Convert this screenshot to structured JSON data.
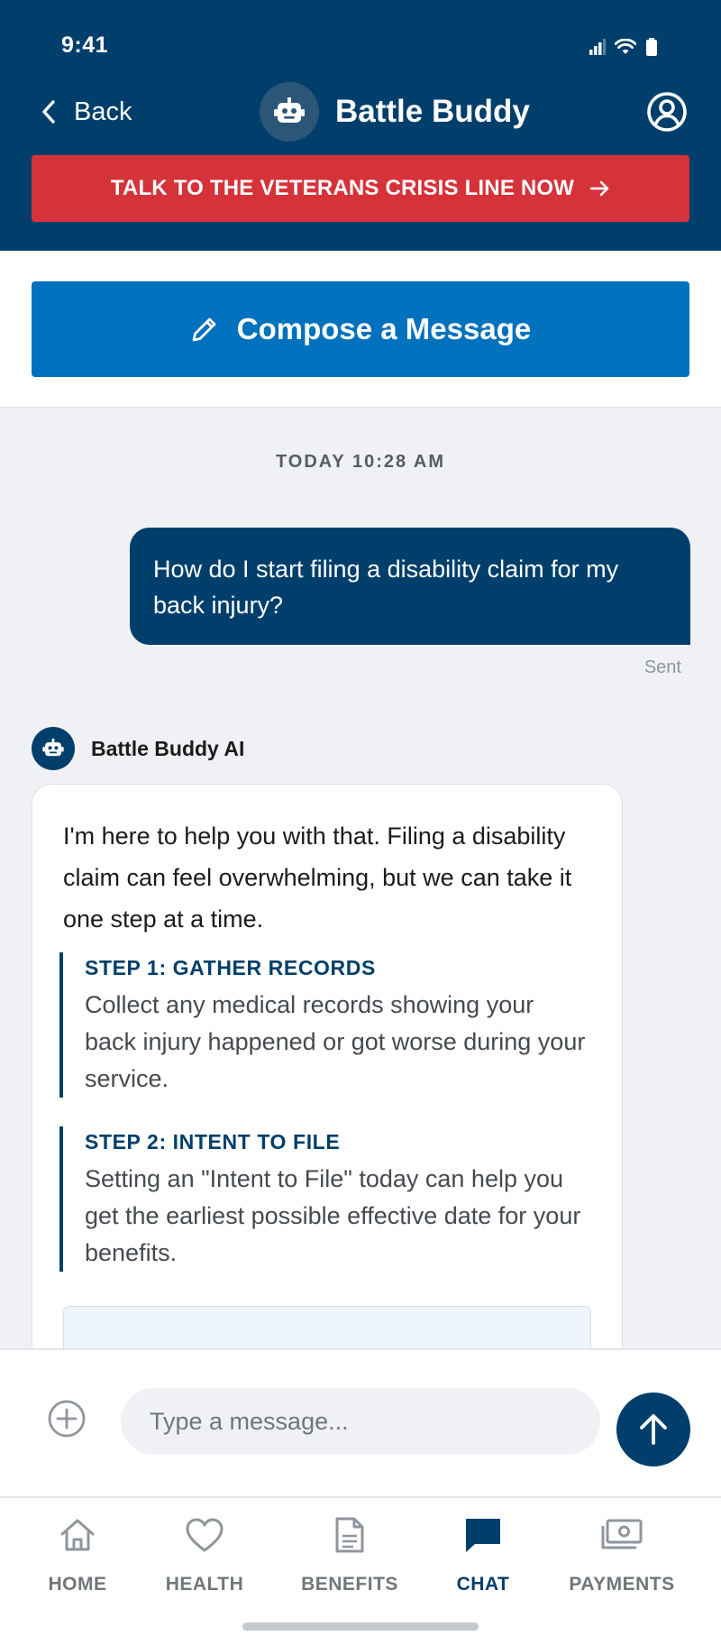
{
  "status_bar": {
    "time": "9:41",
    "icons": [
      "signal-icon",
      "wifi-icon",
      "battery-icon"
    ]
  },
  "header": {
    "back_label": "Back",
    "title": "Battle Buddy",
    "crisis_label": "TALK TO THE VETERANS CRISIS LINE NOW"
  },
  "compose": {
    "label": "Compose a Message"
  },
  "chat": {
    "timestamp": "TODAY 10:28 AM",
    "user_message": "How do I start filing a disability claim for my back injury?",
    "sent_status": "Sent",
    "ai_name": "Battle Buddy AI",
    "ai_intro": "I'm here to help you with that. Filing a disability claim can feel overwhelming, but we can take it one step at a time.",
    "steps": [
      {
        "title": "STEP 1: GATHER RECORDS",
        "body": "Collect any medical records showing your back injury happened or got worse during your service."
      },
      {
        "title": "STEP 2: INTENT TO FILE",
        "body": "Setting an \"Intent to File\" today can help you get the earliest possible effective date for your benefits."
      }
    ]
  },
  "composer": {
    "placeholder": "Type a message..."
  },
  "tabs": [
    {
      "label": "HOME",
      "icon": "home-icon"
    },
    {
      "label": "HEALTH",
      "icon": "heart-icon"
    },
    {
      "label": "BENEFITS",
      "icon": "document-icon"
    },
    {
      "label": "CHAT",
      "icon": "chat-icon",
      "active": true
    },
    {
      "label": "PAYMENTS",
      "icon": "payments-icon"
    }
  ],
  "colors": {
    "primary_dark": "#003f6b",
    "primary_blue": "#0071bc",
    "crisis_red": "#d6323a",
    "chat_background": "#f0f1f4"
  }
}
